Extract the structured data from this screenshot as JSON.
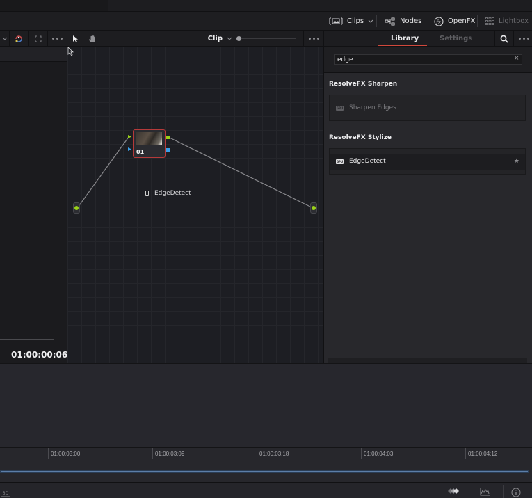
{
  "main_toolbar": {
    "clips_label": "Clips",
    "nodes_label": "Nodes",
    "openfx_label": "OpenFX",
    "lightbox_label": "Lightbox"
  },
  "node_toolbar": {
    "mode_label": "Clip"
  },
  "viewer": {
    "timecode": "01:00:00:06"
  },
  "node_graph": {
    "nodes": [
      {
        "label": "01"
      }
    ],
    "drag_ghost_label": "EdgeDetect"
  },
  "library": {
    "tabs": [
      {
        "label": "Library",
        "active": true
      },
      {
        "label": "Settings",
        "active": false
      }
    ],
    "search": {
      "value": "edge"
    },
    "clear_icon": "×",
    "sections": [
      {
        "title": "ResolveFX Sharpen",
        "items": [
          {
            "label": "Sharpen Edges",
            "badge": "GPU"
          }
        ]
      },
      {
        "title": "ResolveFX Stylize",
        "items": [
          {
            "label": "EdgeDetect",
            "badge": "GPU",
            "favorite_icon": "★"
          }
        ]
      }
    ]
  },
  "timeline": {
    "ruler_labels": [
      "01:00:03:00",
      "01:00:03:09",
      "01:00:03:18",
      "01:00:04:03",
      "01:00:04:12"
    ]
  },
  "bottom_bar": {
    "btn_3d_label": "3D"
  },
  "colors": {
    "accent_red": "#d0483c",
    "node_border_red": "#b53a3a",
    "port_green": "#9ad119",
    "port_blue": "#3aa0e8",
    "clip_blue": "#5c7ea8"
  }
}
